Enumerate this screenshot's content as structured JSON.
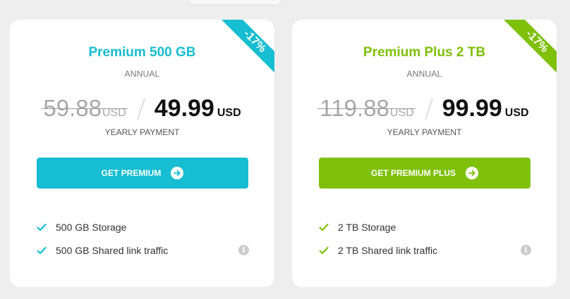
{
  "plans": [
    {
      "name": "Premium 500 GB",
      "period": "ANNUAL",
      "discount_badge": "-17%",
      "old_price": "59.88",
      "old_currency": "USD",
      "new_price": "49.99",
      "new_currency": "USD",
      "payment_label": "YEARLY PAYMENT",
      "cta_label": "GET PREMIUM",
      "cta_icon": "arrow-right-circle-icon",
      "features": [
        "500 GB Storage",
        "500 GB Shared link traffic"
      ],
      "accent_color": "#17bdd1"
    },
    {
      "name": "Premium Plus 2 TB",
      "period": "ANNUAL",
      "discount_badge": "-17%",
      "old_price": "119.88",
      "old_currency": "USD",
      "new_price": "99.99",
      "new_currency": "USD",
      "payment_label": "YEARLY PAYMENT",
      "cta_label": "GET PREMIUM PLUS",
      "cta_icon": "arrow-right-circle-icon",
      "features": [
        "2 TB Storage",
        "2 TB Shared link traffic"
      ],
      "accent_color": "#7fc00b"
    }
  ]
}
